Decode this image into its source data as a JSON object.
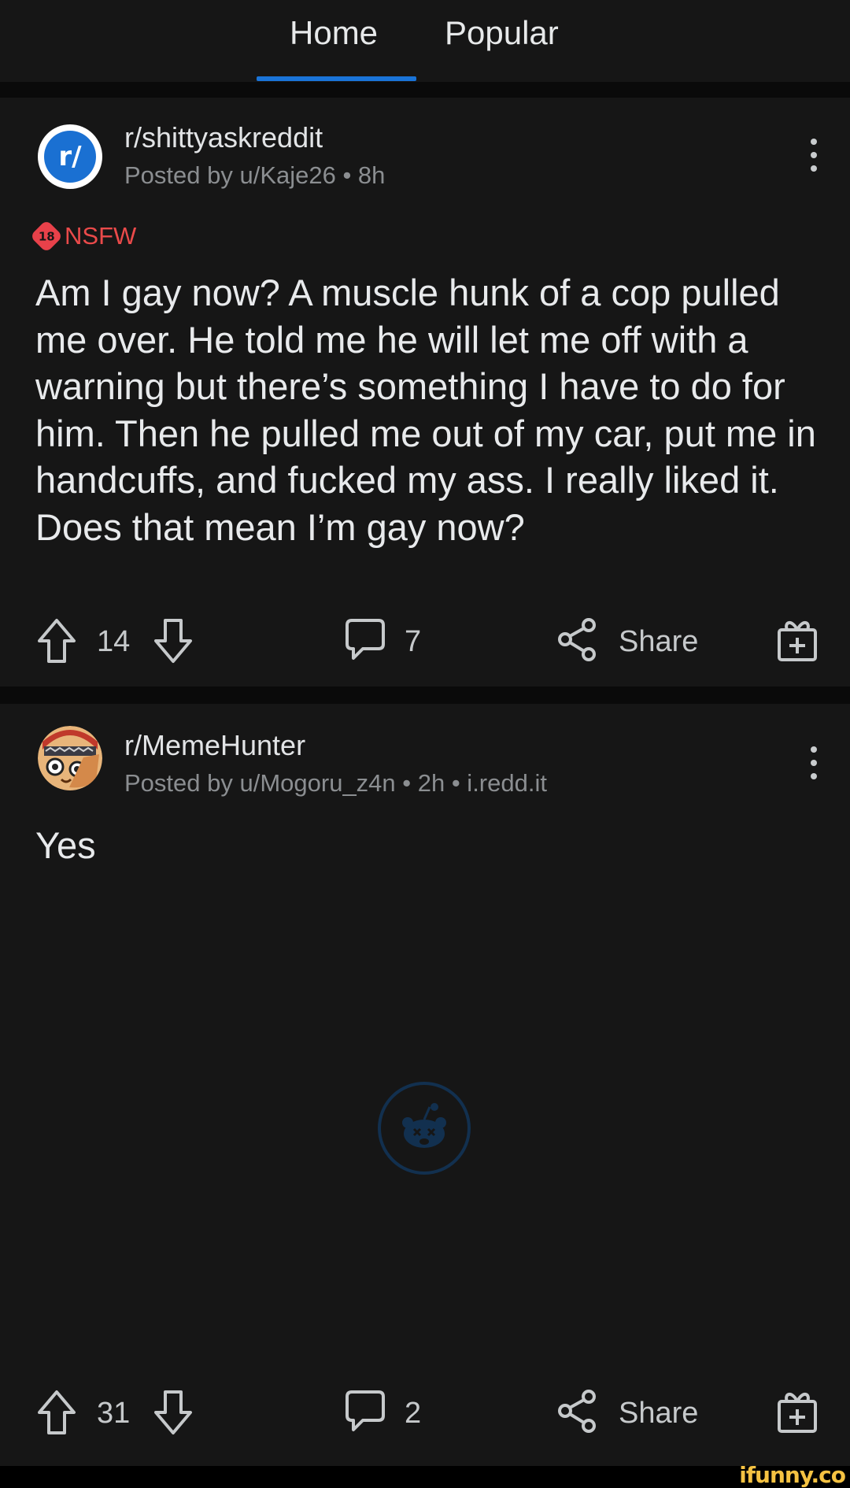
{
  "tabs": [
    {
      "label": "Home",
      "active": true
    },
    {
      "label": "Popular",
      "active": false
    }
  ],
  "accent_color": "#1a74d8",
  "posts": [
    {
      "subreddit": "r/shittyaskreddit",
      "avatar_text": "r/",
      "meta": "Posted by u/Kaje26 • 8h",
      "nsfw_badge": "18",
      "nsfw_label": "NSFW",
      "title": "Am I gay now? A muscle hunk of a cop pulled me over. He told me he will let me off with a warning but there’s something I have to do for him. Then he pulled me out of my car, put me in handcuffs, and fucked my ass. I really liked it. Does that mean I’m gay now?",
      "upvotes": "14",
      "comments": "7",
      "share_label": "Share"
    },
    {
      "subreddit": "r/MemeHunter",
      "meta": "Posted by u/Mogoru_z4n • 2h • i.redd.it",
      "title": "Yes",
      "upvotes": "31",
      "comments": "2",
      "share_label": "Share"
    }
  ],
  "icons": [
    "upvote-arrow",
    "downvote-arrow",
    "comment-bubble",
    "share-nodes",
    "gift-award",
    "more-vertical",
    "reddit-snoo-loading"
  ],
  "watermark": "ifunny.co"
}
